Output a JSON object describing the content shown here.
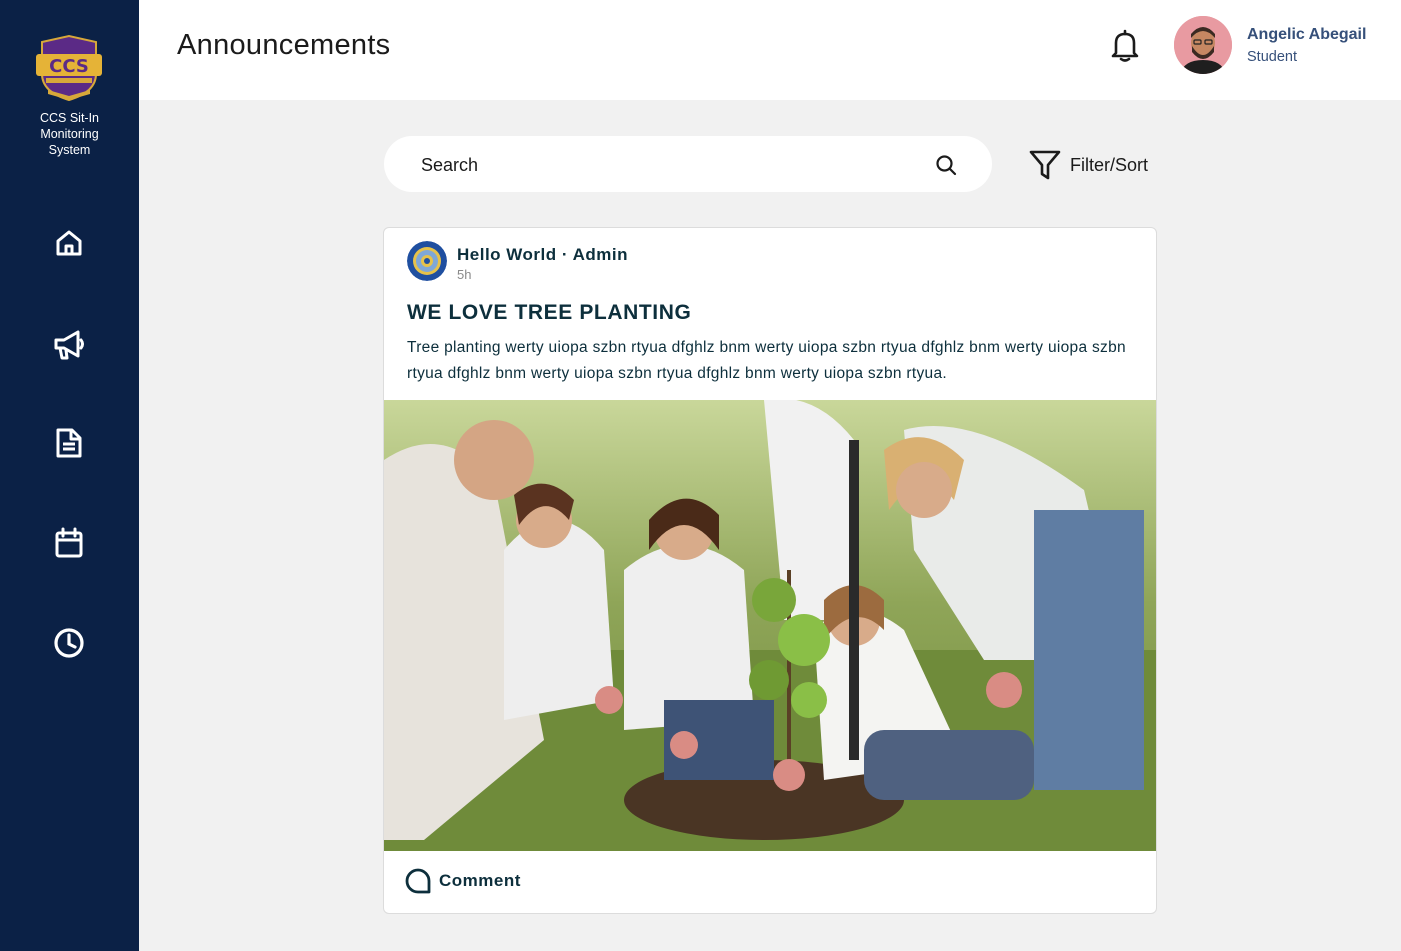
{
  "sidebar": {
    "brand_lines": [
      "CCS Sit-In",
      "Monitoring",
      "System"
    ],
    "nav": [
      {
        "icon": "home-icon"
      },
      {
        "icon": "megaphone-icon"
      },
      {
        "icon": "document-icon"
      },
      {
        "icon": "calendar-icon"
      },
      {
        "icon": "clock-icon"
      }
    ]
  },
  "header": {
    "title": "Announcements",
    "notification_icon": "bell-icon",
    "user": {
      "name": "Angelic Abegail",
      "role": "Student"
    }
  },
  "search": {
    "placeholder": "Search",
    "icon": "search-icon"
  },
  "filter": {
    "label": "Filter/Sort",
    "icon": "filter-icon"
  },
  "post": {
    "author": "Hello World · Admin",
    "time": "5h",
    "title": "WE LOVE TREE PLANTING",
    "body": "Tree planting werty uiopa szbn rtyua dfghlz bnm werty uiopa szbn rtyua dfghlz bnm werty uiopa szbn rtyua dfghlz bnm werty uiopa szbn rtyua dfghlz bnm werty uiopa szbn rtyua.",
    "comment_label": "Comment"
  },
  "colors": {
    "sidebar": "#0b2146",
    "background": "#f1f1f1",
    "text_dark": "#0d2f3c",
    "user_text": "#36507a"
  }
}
